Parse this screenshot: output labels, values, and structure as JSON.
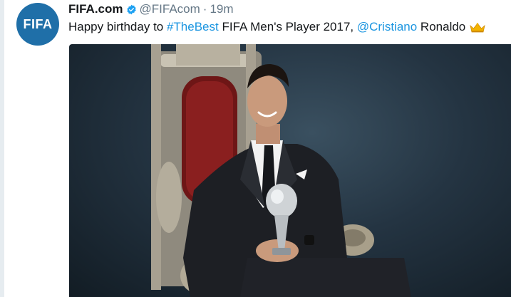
{
  "tweet": {
    "author_name": "FIFA.com",
    "handle": "@FIFAcom",
    "separator": "·",
    "time": "19m",
    "avatar_text": "FIFA",
    "text_before": "Happy birthday to ",
    "hashtag": "#TheBest",
    "text_middle": " FIFA Men's Player 2017, ",
    "mention": "@Cristiano",
    "text_after": " Ronaldo"
  },
  "icons": {
    "verified": "verified-badge-icon",
    "crown": "crown-emoji-icon"
  },
  "colors": {
    "link": "#1b95e0",
    "avatar_bg": "#1f6fa8",
    "verified": "#1da1f2"
  }
}
